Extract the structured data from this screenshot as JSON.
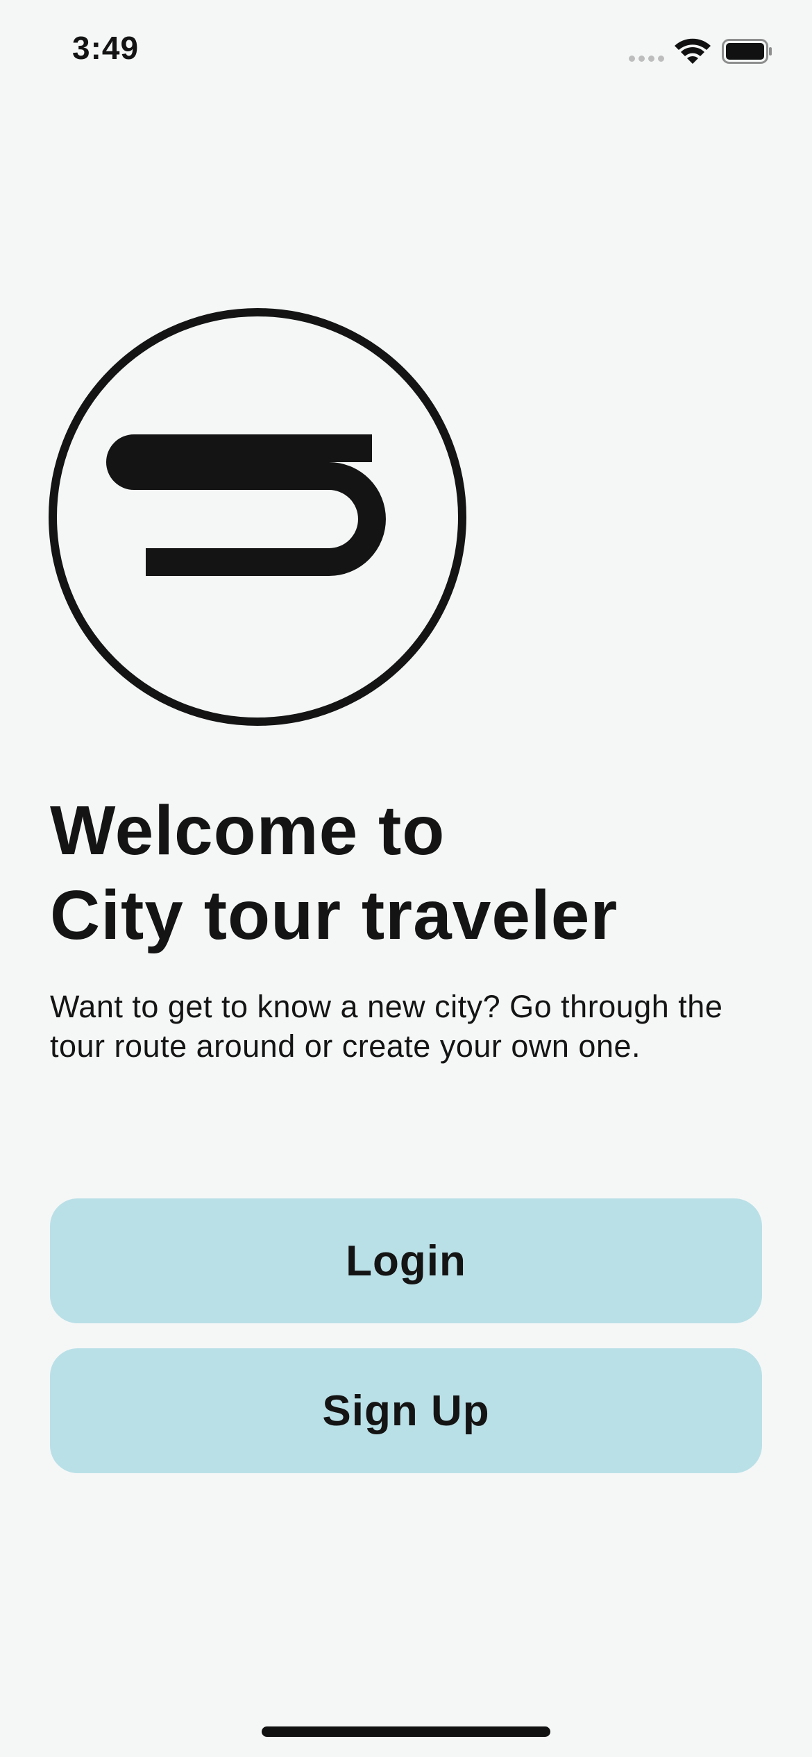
{
  "status_bar": {
    "time": "3:49",
    "icons": [
      "signal-dots-icon",
      "wifi-icon",
      "battery-icon"
    ]
  },
  "logo": {
    "icon": "s-circle-logo",
    "color": "#141414"
  },
  "welcome": {
    "title_line1": "Welcome to",
    "title_line2": "City tour traveler",
    "description": "Want to get to know a new city? Go through the tour route around or create your own one."
  },
  "buttons": {
    "login_label": "Login",
    "signup_label": "Sign Up"
  },
  "colors": {
    "background": "#f5f7f7",
    "button": "#bae0e7",
    "text": "#141414"
  }
}
